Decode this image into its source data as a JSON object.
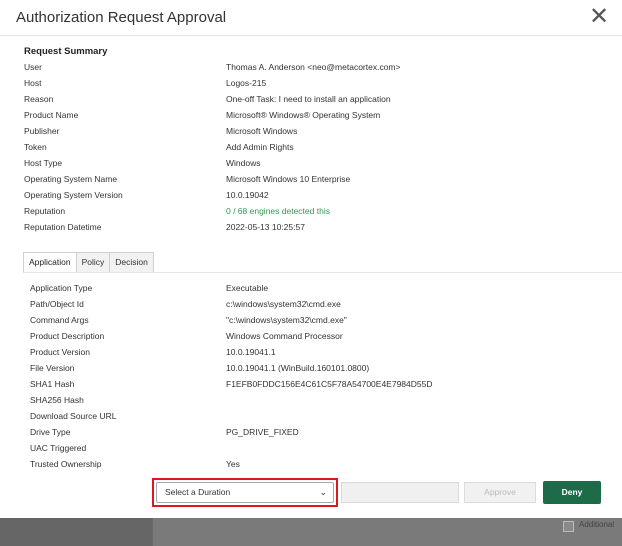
{
  "dialog": {
    "title": "Authorization Request Approval",
    "close": "✕"
  },
  "summary": {
    "heading": "Request Summary",
    "rows": [
      {
        "k": "User",
        "v": "Thomas A. Anderson <neo@metacortex.com>"
      },
      {
        "k": "Host",
        "v": "Logos-215"
      },
      {
        "k": "Reason",
        "v": "One-off Task: I need to install an application"
      },
      {
        "k": "Product Name",
        "v": "Microsoft® Windows® Operating System"
      },
      {
        "k": "Publisher",
        "v": "Microsoft Windows"
      },
      {
        "k": "Token",
        "v": "Add Admin Rights"
      },
      {
        "k": "Host Type",
        "v": "Windows"
      },
      {
        "k": "Operating System Name",
        "v": "Microsoft Windows 10 Enterprise"
      },
      {
        "k": "Operating System Version",
        "v": "10.0.19042"
      },
      {
        "k": "Reputation",
        "v": "0 / 68 engines detected this"
      },
      {
        "k": "Reputation Datetime",
        "v": "2022-05-13 10:25:57"
      }
    ]
  },
  "tabs": [
    "Application",
    "Policy",
    "Decision"
  ],
  "application": {
    "rows": [
      {
        "k": "Application Type",
        "v": "Executable"
      },
      {
        "k": "Path/Object Id",
        "v": "c:\\windows\\system32\\cmd.exe"
      },
      {
        "k": "Command Args",
        "v": "\"c:\\windows\\system32\\cmd.exe\""
      },
      {
        "k": "Product Description",
        "v": "Windows Command Processor"
      },
      {
        "k": "Product Version",
        "v": "10.0.19041.1"
      },
      {
        "k": "File Version",
        "v": "10.0.19041.1 (WinBuild.160101.0800)"
      },
      {
        "k": "SHA1 Hash",
        "v": "F1EFB0FDDC156E4C61C5F78A54700E4E7984D55D"
      },
      {
        "k": "SHA256 Hash",
        "v": ""
      },
      {
        "k": "Download Source URL",
        "v": ""
      },
      {
        "k": "Drive Type",
        "v": "PG_DRIVE_FIXED"
      },
      {
        "k": "UAC Triggered",
        "v": ""
      },
      {
        "k": "Trusted Ownership",
        "v": "Yes"
      }
    ]
  },
  "footer": {
    "duration_select": "Select a Duration",
    "approve": "Approve",
    "deny": "Deny"
  },
  "background": {
    "additional_label": "Additional"
  },
  "colors": {
    "deny": "#1e6b4a",
    "reputation": "#2e9a53",
    "highlight": "#e0161f"
  }
}
